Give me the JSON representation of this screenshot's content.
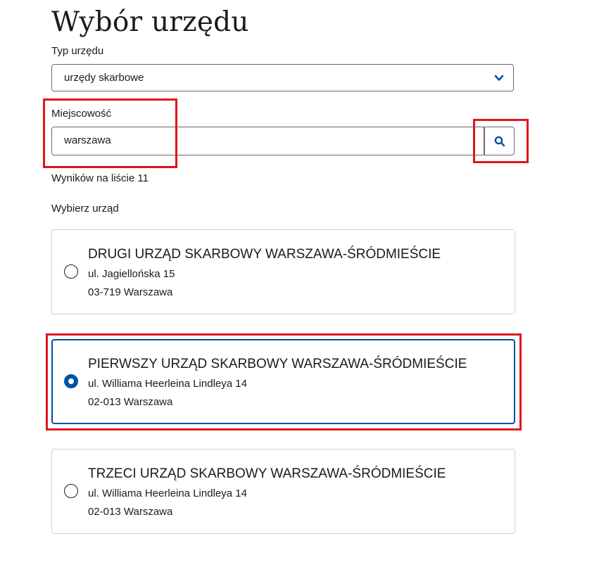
{
  "page": {
    "title": "Wybór urzędu"
  },
  "office_type": {
    "label": "Typ urzędu",
    "selected": "urzędy skarbowe"
  },
  "locality": {
    "label": "Miejscowość",
    "value": "warszawa",
    "search_icon": "search-icon"
  },
  "results": {
    "count_text": "Wyników na liście 11",
    "choose_label": "Wybierz urząd"
  },
  "offices": [
    {
      "name": "DRUGI URZĄD SKARBOWY WARSZAWA-ŚRÓDMIEŚCIE",
      "street": "ul. Jagiellońska 15",
      "city": "03-719 Warszawa",
      "selected": false
    },
    {
      "name": "PIERWSZY URZĄD SKARBOWY WARSZAWA-ŚRÓDMIEŚCIE",
      "street": "ul. Williama Heerleina Lindleya 14",
      "city": "02-013 Warszawa",
      "selected": true
    },
    {
      "name": "TRZECI URZĄD SKARBOWY WARSZAWA-ŚRÓDMIEŚCIE",
      "street": "ul. Williama Heerleina Lindleya 14",
      "city": "02-013 Warszawa",
      "selected": false
    }
  ],
  "colors": {
    "accent": "#0052a5",
    "highlight": "#e0161b",
    "text": "#1b1b1b",
    "border": "#6b6b6b"
  }
}
